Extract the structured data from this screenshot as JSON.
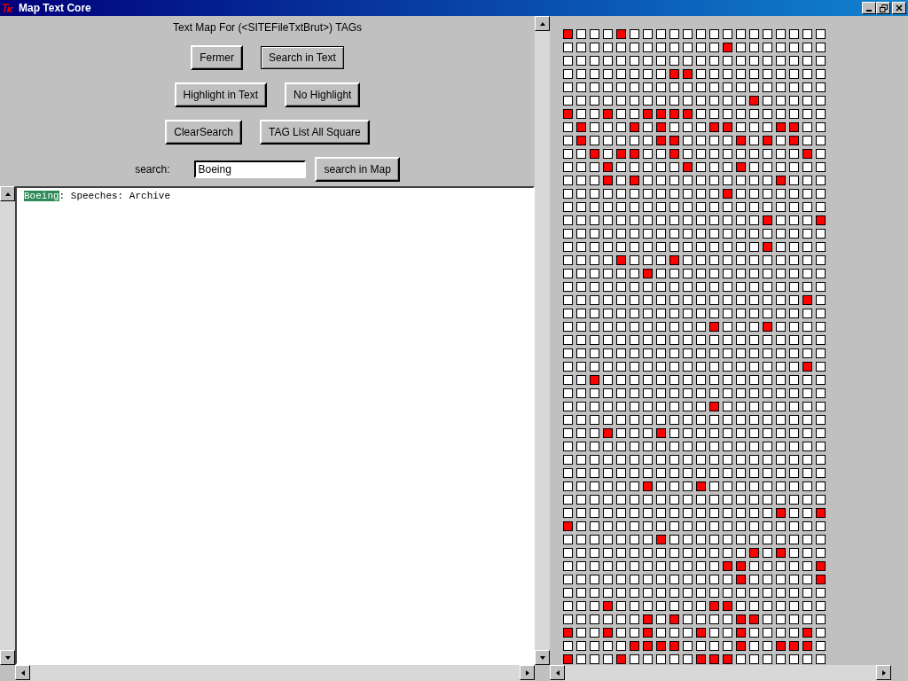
{
  "window": {
    "title": "Map Text Core"
  },
  "heading": "Text Map For (<SITEFileTxtBrut>) TAGs",
  "button_rows": [
    [
      {
        "label": "Fermer",
        "focused": false
      },
      {
        "label": "Search in Text",
        "focused": true
      }
    ],
    [
      {
        "label": "Highlight in Text",
        "focused": false
      },
      {
        "label": "No Highlight",
        "focused": false
      }
    ],
    [
      {
        "label": "ClearSearch",
        "focused": false
      },
      {
        "label": "TAG List All Square",
        "focused": false
      }
    ]
  ],
  "search": {
    "label": "search:",
    "value": "Boeing",
    "button": "search in Map"
  },
  "text": {
    "lines": [
      [
        {
          "text": "Boeing",
          "highlighted": true
        },
        {
          "text": ": Speeches: Archive",
          "highlighted": false
        }
      ]
    ]
  },
  "map": {
    "rows": [
      [
        true,
        false,
        false,
        false,
        true,
        false,
        false,
        false,
        false,
        false,
        false,
        false,
        false,
        false,
        false,
        false,
        false,
        false,
        false,
        false
      ],
      [
        false,
        false,
        false,
        false,
        false,
        false,
        false,
        false,
        false,
        false,
        false,
        false,
        true,
        false,
        false,
        false,
        false,
        false,
        false,
        false
      ],
      [
        false,
        false,
        false,
        false,
        false,
        false,
        false,
        false,
        false,
        false,
        false,
        false,
        false,
        false,
        false,
        false,
        false,
        false,
        false,
        false
      ],
      [
        false,
        false,
        false,
        false,
        false,
        false,
        false,
        false,
        true,
        true,
        false,
        false,
        false,
        false,
        false,
        false,
        false,
        false,
        false,
        false
      ],
      [
        false,
        false,
        false,
        false,
        false,
        false,
        false,
        false,
        false,
        false,
        false,
        false,
        false,
        false,
        false,
        false,
        false,
        false,
        false,
        false
      ],
      [
        false,
        false,
        false,
        false,
        false,
        false,
        false,
        false,
        false,
        false,
        false,
        false,
        false,
        false,
        true,
        false,
        false,
        false,
        false,
        false
      ],
      [
        true,
        false,
        false,
        true,
        false,
        false,
        true,
        true,
        true,
        true,
        false,
        false,
        false,
        false,
        false,
        false,
        false,
        false,
        false,
        false
      ],
      [
        false,
        true,
        false,
        false,
        false,
        true,
        false,
        true,
        false,
        false,
        false,
        true,
        true,
        false,
        false,
        false,
        true,
        true,
        false,
        false
      ],
      [
        false,
        true,
        false,
        false,
        false,
        false,
        false,
        true,
        true,
        false,
        false,
        false,
        false,
        true,
        false,
        true,
        false,
        true,
        false,
        false
      ],
      [
        false,
        false,
        true,
        false,
        true,
        true,
        false,
        false,
        true,
        false,
        false,
        false,
        false,
        false,
        false,
        false,
        false,
        false,
        true,
        false
      ],
      [
        false,
        false,
        false,
        true,
        false,
        false,
        false,
        false,
        false,
        true,
        false,
        false,
        false,
        true,
        false,
        false,
        false,
        false,
        false,
        false
      ],
      [
        false,
        false,
        false,
        true,
        false,
        true,
        false,
        false,
        false,
        false,
        false,
        false,
        false,
        false,
        false,
        false,
        true,
        false,
        false,
        false
      ],
      [
        false,
        false,
        false,
        false,
        false,
        false,
        false,
        false,
        false,
        false,
        false,
        false,
        true,
        false,
        false,
        false,
        false,
        false,
        false,
        false
      ],
      [
        false,
        false,
        false,
        false,
        false,
        false,
        false,
        false,
        false,
        false,
        false,
        false,
        false,
        false,
        false,
        false,
        false,
        false,
        false,
        false
      ],
      [
        false,
        false,
        false,
        false,
        false,
        false,
        false,
        false,
        false,
        false,
        false,
        false,
        false,
        false,
        false,
        true,
        false,
        false,
        false,
        true
      ],
      [
        false,
        false,
        false,
        false,
        false,
        false,
        false,
        false,
        false,
        false,
        false,
        false,
        false,
        false,
        false,
        false,
        false,
        false,
        false,
        false
      ],
      [
        false,
        false,
        false,
        false,
        false,
        false,
        false,
        false,
        false,
        false,
        false,
        false,
        false,
        false,
        false,
        true,
        false,
        false,
        false,
        false
      ],
      [
        false,
        false,
        false,
        false,
        true,
        false,
        false,
        false,
        true,
        false,
        false,
        false,
        false,
        false,
        false,
        false,
        false,
        false,
        false,
        false
      ],
      [
        false,
        false,
        false,
        false,
        false,
        false,
        true,
        false,
        false,
        false,
        false,
        false,
        false,
        false,
        false,
        false,
        false,
        false,
        false,
        false
      ],
      [
        false,
        false,
        false,
        false,
        false,
        false,
        false,
        false,
        false,
        false,
        false,
        false,
        false,
        false,
        false,
        false,
        false,
        false,
        false,
        false
      ],
      [
        false,
        false,
        false,
        false,
        false,
        false,
        false,
        false,
        false,
        false,
        false,
        false,
        false,
        false,
        false,
        false,
        false,
        false,
        true,
        false
      ],
      [
        false,
        false,
        false,
        false,
        false,
        false,
        false,
        false,
        false,
        false,
        false,
        false,
        false,
        false,
        false,
        false,
        false,
        false,
        false,
        false
      ],
      [
        false,
        false,
        false,
        false,
        false,
        false,
        false,
        false,
        false,
        false,
        false,
        true,
        false,
        false,
        false,
        true,
        false,
        false,
        false,
        false
      ],
      [
        false,
        false,
        false,
        false,
        false,
        false,
        false,
        false,
        false,
        false,
        false,
        false,
        false,
        false,
        false,
        false,
        false,
        false,
        false,
        false
      ],
      [
        false,
        false,
        false,
        false,
        false,
        false,
        false,
        false,
        false,
        false,
        false,
        false,
        false,
        false,
        false,
        false,
        false,
        false,
        false,
        false
      ],
      [
        false,
        false,
        false,
        false,
        false,
        false,
        false,
        false,
        false,
        false,
        false,
        false,
        false,
        false,
        false,
        false,
        false,
        false,
        true,
        false
      ],
      [
        false,
        false,
        true,
        false,
        false,
        false,
        false,
        false,
        false,
        false,
        false,
        false,
        false,
        false,
        false,
        false,
        false,
        false,
        false,
        false
      ],
      [
        false,
        false,
        false,
        false,
        false,
        false,
        false,
        false,
        false,
        false,
        false,
        false,
        false,
        false,
        false,
        false,
        false,
        false,
        false,
        false
      ],
      [
        false,
        false,
        false,
        false,
        false,
        false,
        false,
        false,
        false,
        false,
        false,
        true,
        false,
        false,
        false,
        false,
        false,
        false,
        false,
        false
      ],
      [
        false,
        false,
        false,
        false,
        false,
        false,
        false,
        false,
        false,
        false,
        false,
        false,
        false,
        false,
        false,
        false,
        false,
        false,
        false,
        false
      ],
      [
        false,
        false,
        false,
        true,
        false,
        false,
        false,
        true,
        false,
        false,
        false,
        false,
        false,
        false,
        false,
        false,
        false,
        false,
        false,
        false
      ],
      [
        false,
        false,
        false,
        false,
        false,
        false,
        false,
        false,
        false,
        false,
        false,
        false,
        false,
        false,
        false,
        false,
        false,
        false,
        false,
        false
      ],
      [
        false,
        false,
        false,
        false,
        false,
        false,
        false,
        false,
        false,
        false,
        false,
        false,
        false,
        false,
        false,
        false,
        false,
        false,
        false,
        false
      ],
      [
        false,
        false,
        false,
        false,
        false,
        false,
        false,
        false,
        false,
        false,
        false,
        false,
        false,
        false,
        false,
        false,
        false,
        false,
        false,
        false
      ],
      [
        false,
        false,
        false,
        false,
        false,
        false,
        true,
        false,
        false,
        false,
        true,
        false,
        false,
        false,
        false,
        false,
        false,
        false,
        false,
        false
      ],
      [
        false,
        false,
        false,
        false,
        false,
        false,
        false,
        false,
        false,
        false,
        false,
        false,
        false,
        false,
        false,
        false,
        false,
        false,
        false,
        false
      ],
      [
        false,
        false,
        false,
        false,
        false,
        false,
        false,
        false,
        false,
        false,
        false,
        false,
        false,
        false,
        false,
        false,
        true,
        false,
        false,
        true
      ],
      [
        true,
        false,
        false,
        false,
        false,
        false,
        false,
        false,
        false,
        false,
        false,
        false,
        false,
        false,
        false,
        false,
        false,
        false,
        false,
        false
      ],
      [
        false,
        false,
        false,
        false,
        false,
        false,
        false,
        true,
        false,
        false,
        false,
        false,
        false,
        false,
        false,
        false,
        false,
        false,
        false,
        false
      ],
      [
        false,
        false,
        false,
        false,
        false,
        false,
        false,
        false,
        false,
        false,
        false,
        false,
        false,
        false,
        true,
        false,
        true,
        false,
        false,
        false
      ],
      [
        false,
        false,
        false,
        false,
        false,
        false,
        false,
        false,
        false,
        false,
        false,
        false,
        true,
        true,
        false,
        false,
        false,
        false,
        false,
        true
      ],
      [
        false,
        false,
        false,
        false,
        false,
        false,
        false,
        false,
        false,
        false,
        false,
        false,
        false,
        true,
        false,
        false,
        false,
        false,
        false,
        true
      ],
      [
        false,
        false,
        false,
        false,
        false,
        false,
        false,
        false,
        false,
        false,
        false,
        false,
        false,
        false,
        false,
        false,
        false,
        false,
        false,
        false
      ],
      [
        false,
        false,
        false,
        true,
        false,
        false,
        false,
        false,
        false,
        false,
        false,
        true,
        true,
        false,
        false,
        false,
        false,
        false,
        false,
        false
      ],
      [
        false,
        false,
        false,
        false,
        false,
        false,
        true,
        false,
        true,
        false,
        false,
        false,
        false,
        true,
        true,
        false,
        false,
        false,
        false,
        false
      ],
      [
        true,
        false,
        false,
        true,
        false,
        false,
        true,
        false,
        false,
        false,
        true,
        false,
        false,
        true,
        false,
        false,
        false,
        false,
        true,
        false
      ],
      [
        false,
        false,
        false,
        false,
        false,
        true,
        true,
        true,
        true,
        false,
        false,
        false,
        false,
        true,
        false,
        false,
        true,
        true,
        true,
        false
      ],
      [
        true,
        false,
        false,
        false,
        true,
        false,
        false,
        false,
        false,
        false,
        true,
        true,
        true,
        false,
        false,
        false,
        false,
        false,
        false,
        false
      ]
    ]
  }
}
